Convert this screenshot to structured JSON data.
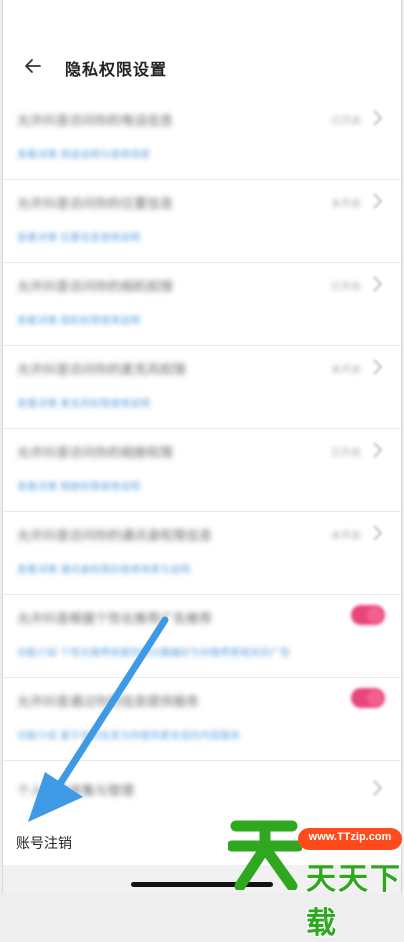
{
  "header": {
    "title": "隐私权限设置",
    "back_icon": "arrow-left-icon"
  },
  "permissions": [
    {
      "title": "允许抖音访问你的电话信息",
      "desc": "查看详情 用途说明与使用场景",
      "status": "已开启",
      "control": "chevron"
    },
    {
      "title": "允许抖音访问你的位置信息",
      "desc": "查看详情 位置信息使用说明",
      "status": "未开启",
      "control": "chevron"
    },
    {
      "title": "允许抖音访问你的相机权限",
      "desc": "查看详情 相机权限使用说明",
      "status": "已开启",
      "control": "chevron"
    },
    {
      "title": "允许抖音访问你的麦克风权限",
      "desc": "查看详情 麦克风权限使用说明",
      "status": "未开启",
      "control": "chevron"
    },
    {
      "title": "允许抖音访问你的相册权限",
      "desc": "查看详情 相册权限使用说明",
      "status": "已开启",
      "control": "chevron"
    },
    {
      "title": "允许抖音访问你的通讯录权限信息",
      "desc": "查看详情 通讯录权限的使用场景与说明",
      "status": "未开启",
      "control": "chevron"
    },
    {
      "title": "允许抖音根据个性化推荐广告推荐",
      "desc": "功能介绍 个性化推荐依据你的兴趣偏好为你推荐更相关的广告",
      "status": "",
      "control": "toggle"
    },
    {
      "title": "允许抖音通过你的信息提供服务",
      "desc": "功能介绍 基于你的信息为你提供更合适的内容服务",
      "status": "",
      "control": "toggle"
    }
  ],
  "personal_info": {
    "title": "个人信息收集与管理"
  },
  "account": {
    "label": "账号注销"
  },
  "overlay": {
    "arrow_color": "#3f9ae6"
  },
  "watermark": {
    "url": "www.TTzip.com",
    "text": "天天下载"
  },
  "colors": {
    "toggle_on": "#e8457a",
    "link": "#3a8fd8"
  }
}
